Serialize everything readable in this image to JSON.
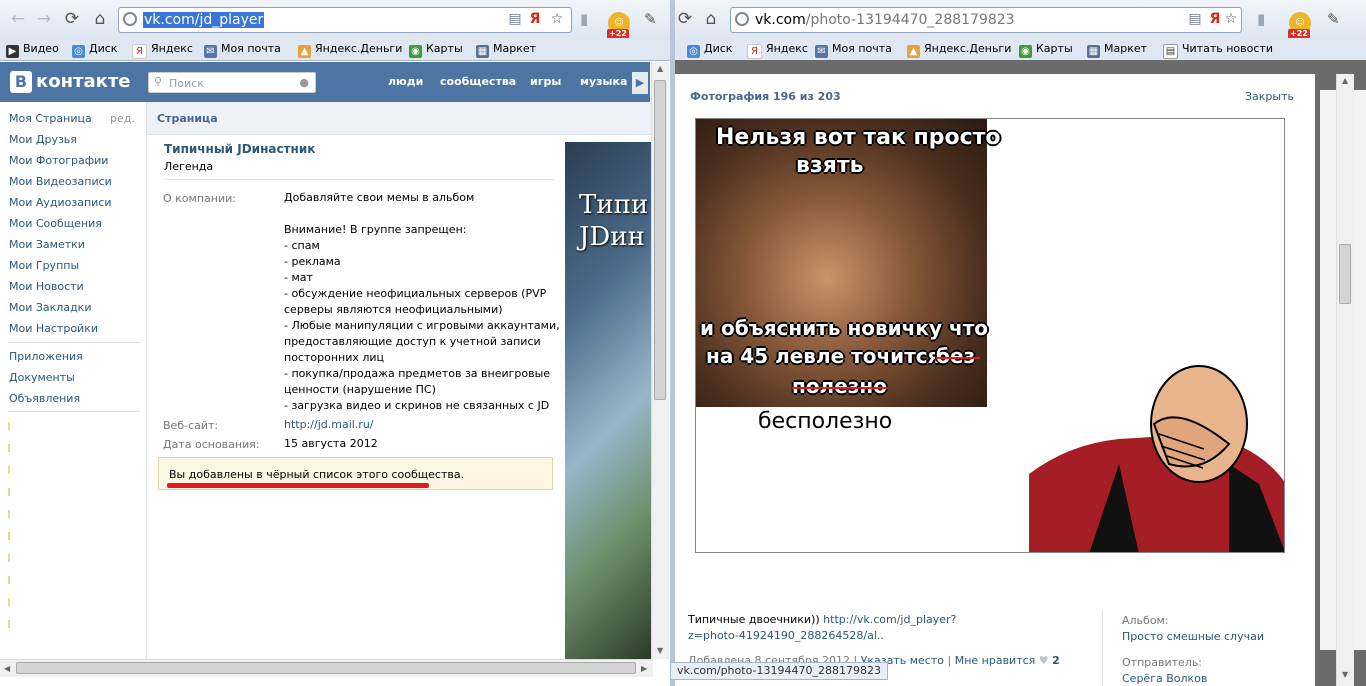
{
  "left_window": {
    "url": "vk.com/jd_player",
    "bookmarks": [
      "Видео",
      "Диск",
      "Яндекс",
      "Моя почта",
      "Яндекс.Деньги",
      "Карты",
      "Маркет"
    ],
    "notify_count": "+22",
    "logo": "контакте",
    "logo_letter": "В",
    "search_placeholder": "Поиск",
    "top_nav": [
      "люди",
      "сообщества",
      "игры",
      "музыка"
    ],
    "sidebar": {
      "items": [
        "Моя Страница",
        "Мои Друзья",
        "Мои Фотографии",
        "Мои Видеозаписи",
        "Мои Аудиозаписи",
        "Мои Сообщения",
        "Мои Заметки",
        "Мои Группы",
        "Мои Новости",
        "Мои Закладки",
        "Мои Настройки"
      ],
      "edit": "ред.",
      "extra": [
        "Приложения",
        "Документы",
        "Объявления"
      ]
    },
    "content": {
      "section_title": "Страница",
      "group_name": "Типичный JDинастник",
      "group_status": "Легенда",
      "about_label": "О компании:",
      "about_lines": [
        "Добавляйте свои мемы в альбом",
        "",
        "Внимание! В группе запрещен:",
        "- спам",
        "- реклама",
        "- мат",
        "- обсуждение неофициальных серверов (PVP",
        "серверы являются неофициальными)",
        "- Любые манипуляции с игровыми аккаунтами,",
        "предоставляющие доступ к учетной записи",
        "посторонних лиц",
        "- покупка/продажа предметов за внеигровые",
        "ценности (нарушение ПС)",
        "- загрузка видео и скринов не связанных с JD"
      ],
      "website_label": "Веб-сайт:",
      "website": "http://jd.mail.ru/",
      "founded_label": "Дата основания:",
      "founded": "15 августа 2012",
      "blacklist_notice": "Вы добавлены в чёрный список этого сообщества.",
      "cover_text": [
        "Типи",
        "JDин"
      ]
    },
    "status_url": "vk.com/photo-13194470_288179823"
  },
  "right_window": {
    "url_host": "vk.com",
    "url_path": "/photo-13194470_288179823",
    "bookmarks": [
      "Диск",
      "Яндекс",
      "Моя почта",
      "Яндекс.Деньги",
      "Карты",
      "Маркет",
      "Читать новости"
    ],
    "notify_count": "+22",
    "viewer": {
      "title": "Фотография 196 из 203",
      "close": "Закрыть",
      "meme_lines": [
        "Нельзя вот так просто",
        "взять",
        "и объяснить новичку что",
        "на 45 левле точится",
        "без",
        "полезно"
      ],
      "meme_bottom": "бесполезно",
      "caption_text": "Типичные двоечники))",
      "caption_link": "http://vk.com/jd_player?z=photo-41924190_288264528/al..",
      "added": "Добавлена 8 сентября 2012",
      "location": "Указать место",
      "like": "Мне нравится",
      "like_count": "2",
      "album_label": "Альбом:",
      "album": "Просто смешные случаи",
      "sender_label": "Отправитель:",
      "sender": "Серёга Волков"
    }
  },
  "colors": {
    "vk_blue": "#4c75a3",
    "link": "#2b587a",
    "notice_bg": "#fdf6e2",
    "underline": "#e11b1b"
  }
}
